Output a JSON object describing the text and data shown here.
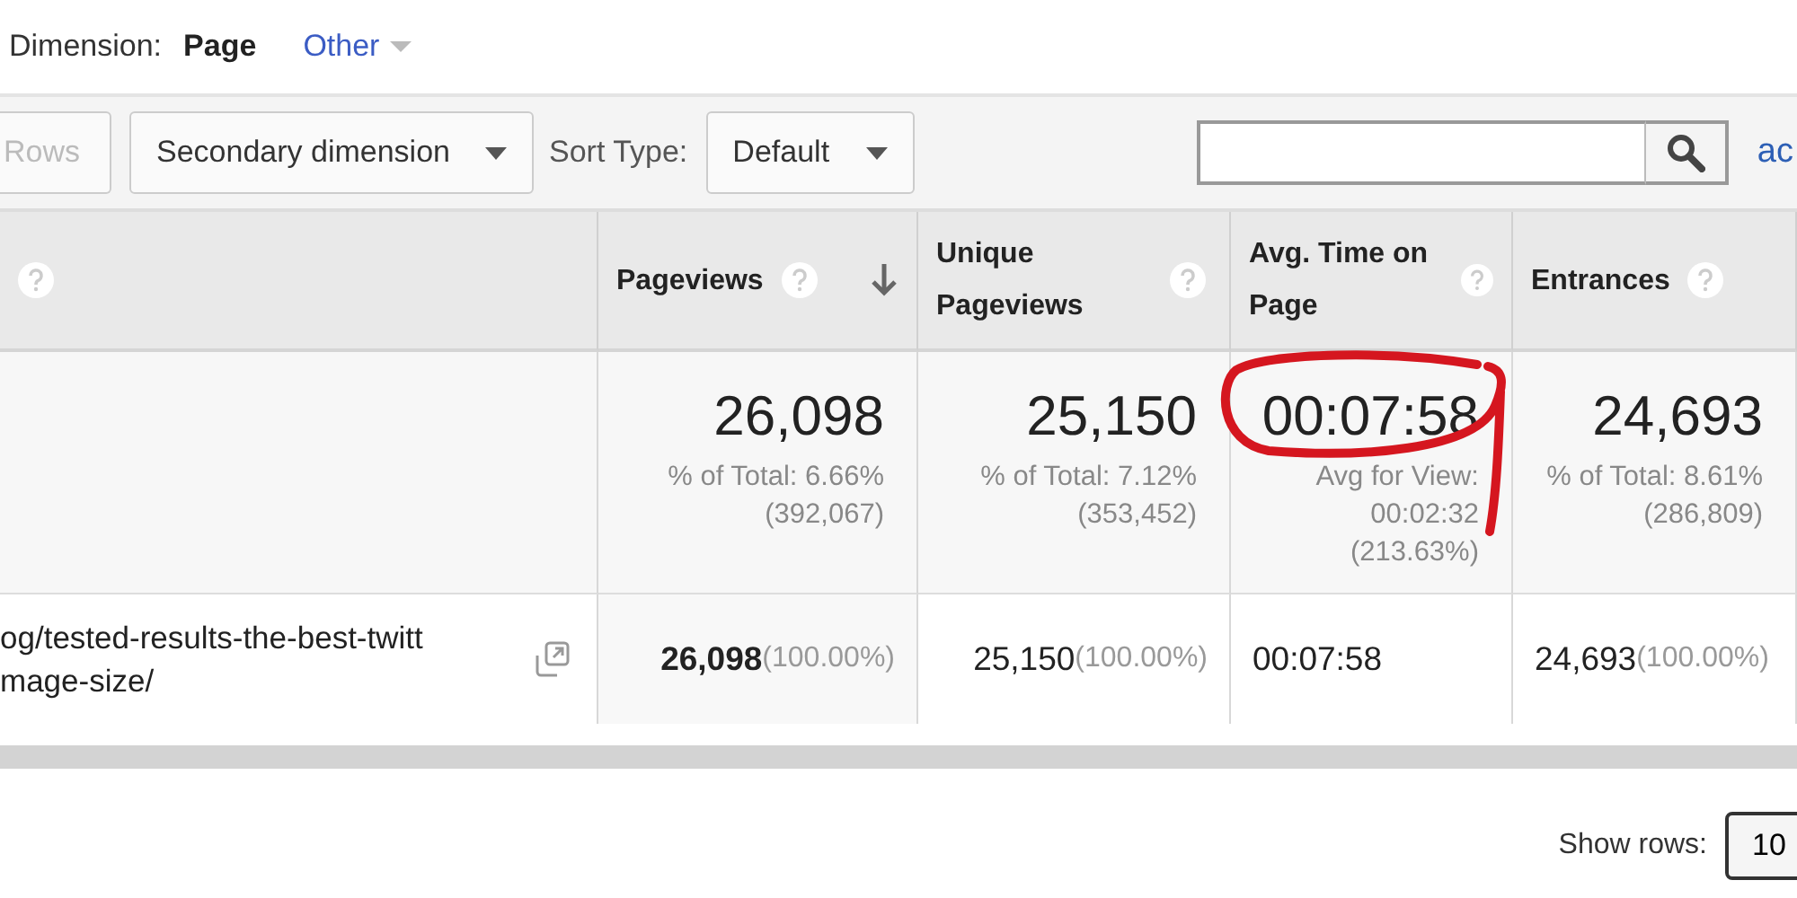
{
  "primary_dimension": {
    "label": "Dimension:",
    "options": [
      {
        "label": "Page",
        "selected": true
      },
      {
        "label": "Other",
        "selected": false
      }
    ]
  },
  "toolbar": {
    "rows_button": {
      "label": "Rows",
      "disabled": true
    },
    "secondary_dimension": "Secondary dimension",
    "sort_type": {
      "label": "Sort Type:",
      "value": "Default"
    },
    "link": "ac"
  },
  "table": {
    "columns": [
      {
        "label": "Pageviews",
        "sorted": true
      },
      {
        "label": "Unique Pageviews",
        "sorted": false
      },
      {
        "label": "Avg. Time on Page",
        "sorted": false
      },
      {
        "label": "Entrances",
        "sorted": false
      }
    ],
    "totals": [
      {
        "value": "26,098",
        "details": [
          "% of Total: 6.66%",
          "(392,067)"
        ]
      },
      {
        "value": "25,150",
        "details": [
          "% of Total: 7.12%",
          "(353,452)"
        ]
      },
      {
        "value": "00:07:58",
        "details": [
          "Avg for View:",
          "00:02:32",
          "(213.63%)"
        ]
      },
      {
        "value": "24,693",
        "details": [
          "% of Total: 8.61%",
          "(286,809)"
        ]
      }
    ],
    "rows": [
      {
        "page": [
          "og/tested-results-the-best-twitt",
          "mage-size/"
        ],
        "cells": [
          {
            "value": "26,098",
            "share": "(100.00%)"
          },
          {
            "value": "25,150",
            "share": "(100.00%)"
          },
          {
            "value": "00:07:58"
          },
          {
            "value": "24,693",
            "share": "(100.00%)"
          }
        ]
      }
    ]
  },
  "footer": {
    "label": "Show rows:",
    "value": "10"
  }
}
